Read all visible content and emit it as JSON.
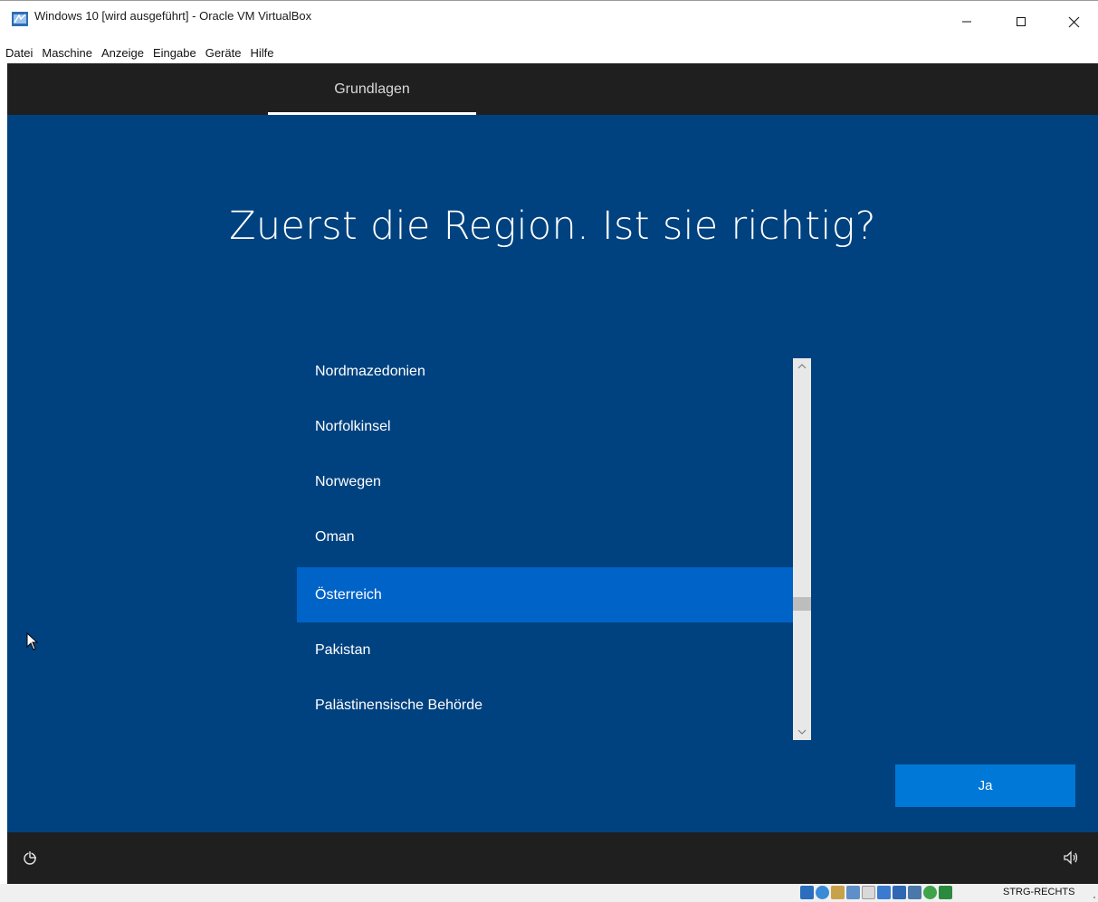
{
  "window": {
    "title": "Windows 10 [wird ausgeführt] - Oracle VM VirtualBox",
    "controls": {
      "minimize_icon": "minimize-icon",
      "maximize_icon": "maximize-icon",
      "close_icon": "close-icon"
    }
  },
  "menu": {
    "items": [
      {
        "label": "Datei"
      },
      {
        "label": "Maschine"
      },
      {
        "label": "Anzeige"
      },
      {
        "label": "Eingabe"
      },
      {
        "label": "Geräte"
      },
      {
        "label": "Hilfe"
      }
    ]
  },
  "oobe": {
    "tab_label": "Grundlagen",
    "heading": "Zuerst die Region. Ist sie richtig?",
    "regions": [
      {
        "label": "Nordmazedonien",
        "selected": false
      },
      {
        "label": "Norfolkinsel",
        "selected": false
      },
      {
        "label": "Norwegen",
        "selected": false
      },
      {
        "label": "Oman",
        "selected": false
      },
      {
        "label": "Österreich",
        "selected": true
      },
      {
        "label": "Pakistan",
        "selected": false
      },
      {
        "label": "Palästinensische Behörde",
        "selected": false
      }
    ],
    "confirm_button": "Ja",
    "colors": {
      "background": "#00427f",
      "selection": "#0063c8",
      "button": "#0078d7",
      "bar": "#1f1f1f"
    }
  },
  "statusbar": {
    "host_key": "STRG-RECHTS",
    "icons": [
      "hard-disk-icon",
      "optical-drive-icon",
      "audio-icon",
      "network-icon",
      "usb-icon",
      "shared-folders-icon",
      "display-icon",
      "video-capture-icon",
      "mouse-integration-icon",
      "keyboard-capture-icon"
    ]
  }
}
